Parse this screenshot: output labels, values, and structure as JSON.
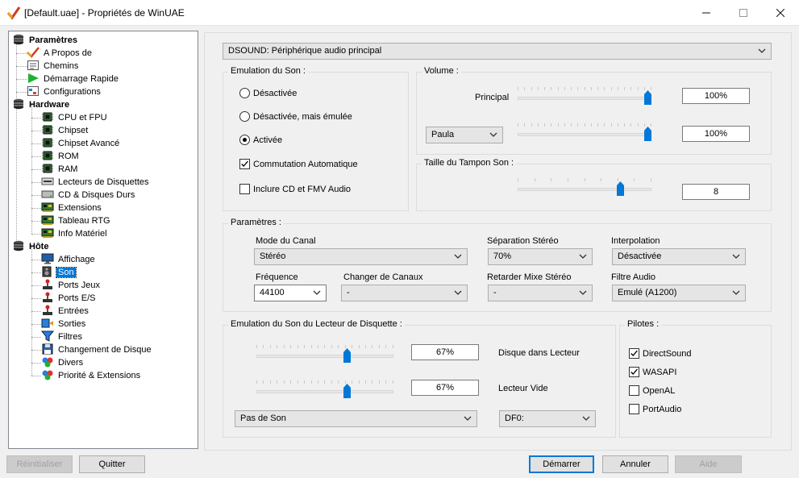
{
  "window": {
    "title": "[Default.uae] - Propriétés de WinUAE",
    "minimize": "—",
    "maximize": "☐",
    "close": "✕"
  },
  "tree": [
    {
      "label": "Paramètres",
      "icon": "disk-stack-icon",
      "bold": true
    },
    {
      "label": "A Propos de",
      "icon": "checkmark-icon"
    },
    {
      "label": "Chemins",
      "icon": "paths-icon"
    },
    {
      "label": "Démarrage Rapide",
      "icon": "play-arrow-icon"
    },
    {
      "label": "Configurations",
      "icon": "config-icon"
    },
    {
      "label": "Hardware",
      "icon": "disk-stack-icon",
      "bold": true
    },
    {
      "label": "CPU et FPU",
      "icon": "chip-icon"
    },
    {
      "label": "Chipset",
      "icon": "chip-icon"
    },
    {
      "label": "Chipset Avancé",
      "icon": "chip-icon"
    },
    {
      "label": "ROM",
      "icon": "chip-icon"
    },
    {
      "label": "RAM",
      "icon": "chip-icon"
    },
    {
      "label": "Lecteurs de Disquettes",
      "icon": "floppy-drive-icon"
    },
    {
      "label": "CD & Disques Durs",
      "icon": "hard-drive-icon"
    },
    {
      "label": "Extensions",
      "icon": "expansion-board-icon"
    },
    {
      "label": "Tableau RTG",
      "icon": "expansion-board-icon"
    },
    {
      "label": "Info Matériel",
      "icon": "expansion-board-icon"
    },
    {
      "label": "Hôte",
      "icon": "disk-stack-icon",
      "bold": true
    },
    {
      "label": "Affichage",
      "icon": "monitor-icon"
    },
    {
      "label": "Son",
      "icon": "speaker-icon",
      "selected": true
    },
    {
      "label": "Ports Jeux",
      "icon": "joystick-icon"
    },
    {
      "label": "Ports E/S",
      "icon": "joystick-icon"
    },
    {
      "label": "Entrées",
      "icon": "joystick-icon"
    },
    {
      "label": "Sorties",
      "icon": "output-icon"
    },
    {
      "label": "Filtres",
      "icon": "filter-icon"
    },
    {
      "label": "Changement de Disque",
      "icon": "floppy-swap-icon"
    },
    {
      "label": "Divers",
      "icon": "misc-icon"
    },
    {
      "label": "Priorité & Extensions",
      "icon": "misc-icon"
    }
  ],
  "device_select": "DSOUND: Périphérique audio principal",
  "emulation": {
    "title": "Emulation du Son :",
    "options": [
      "Désactivée",
      "Désactivée, mais émulée",
      "Activée"
    ],
    "selected_index": 2,
    "auto_switch": {
      "label": "Commutation Automatique",
      "checked": true
    },
    "cd_fmv": {
      "label": "Inclure CD et FMV Audio",
      "checked": false
    }
  },
  "volume": {
    "title": "Volume :",
    "principal_label": "Principal",
    "principal_value": "100%",
    "principal_level": 1.0,
    "paula_select": "Paula",
    "paula_value": "100%",
    "paula_level": 1.0
  },
  "buffer": {
    "title": "Taille du Tampon Son :",
    "value": "8",
    "level": 0.78
  },
  "params": {
    "title": "Paramètres :",
    "channel_mode_label": "Mode du Canal",
    "channel_mode": "Stéréo",
    "separation_label": "Séparation Stéréo",
    "separation": "70%",
    "interpolation_label": "Interpolation",
    "interpolation": "Désactivée",
    "frequency_label": "Fréquence",
    "frequency": "44100",
    "swap_label": "Changer de Canaux",
    "swap": "-",
    "delay_label": "Retarder Mixe Stéréo",
    "delay": "-",
    "filter_label": "Filtre Audio",
    "filter": "Emulé (A1200)"
  },
  "floppy_sound": {
    "title": "Emulation du Son du Lecteur de Disquette :",
    "disk_in_value": "67%",
    "disk_in_level": 0.67,
    "disk_in_label": "Disque dans Lecteur",
    "empty_value": "67%",
    "empty_level": 0.67,
    "empty_label": "Lecteur Vide",
    "sound_select": "Pas de Son",
    "drive_select": "DF0:"
  },
  "drivers": {
    "title": "Pilotes :",
    "items": [
      {
        "label": "DirectSound",
        "checked": true
      },
      {
        "label": "WASAPI",
        "checked": true
      },
      {
        "label": "OpenAL",
        "checked": false
      },
      {
        "label": "PortAudio",
        "checked": false
      }
    ]
  },
  "buttons": {
    "reset": "Réinitialiser",
    "quit": "Quitter",
    "start": "Démarrer",
    "cancel": "Annuler",
    "help": "Aide"
  }
}
